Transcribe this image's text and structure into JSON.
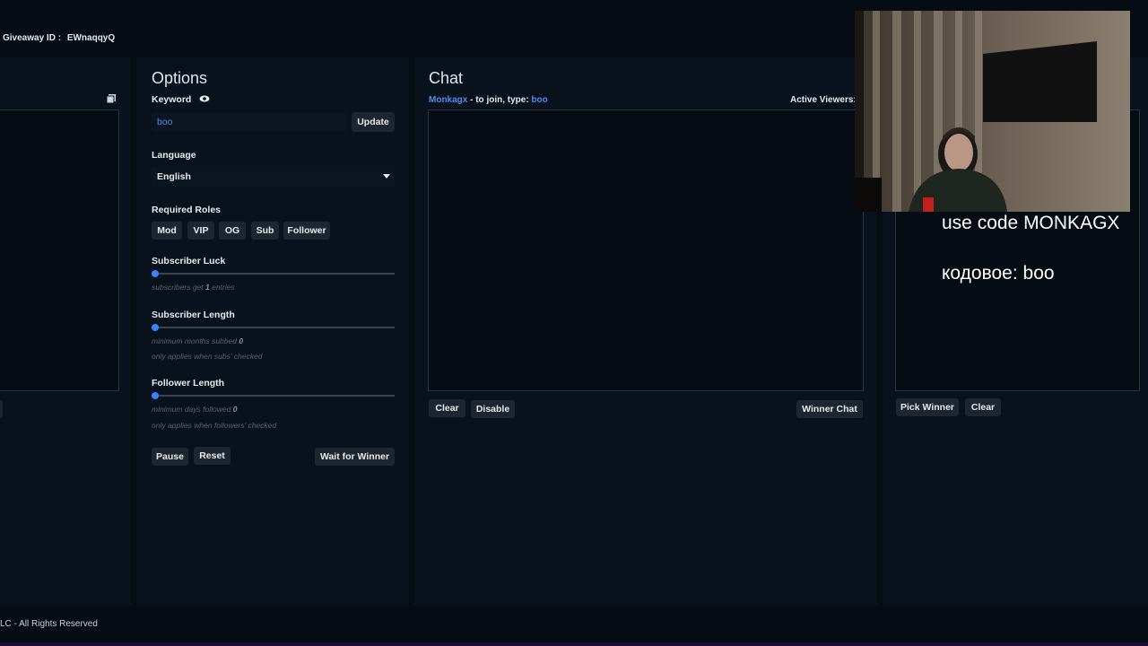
{
  "header": {
    "giveaway_label": "Giveaway ID :",
    "giveaway_id": "EWnaqqyQ"
  },
  "options": {
    "title": "Options",
    "keyword_label": "Keyword",
    "keyword_value": "boo",
    "update_button": "Update",
    "language_label": "Language",
    "language_value": "English",
    "required_roles_label": "Required Roles",
    "roles": [
      "Mod",
      "VIP",
      "OG",
      "Sub",
      "Follower"
    ],
    "subscriber_luck_label": "Subscriber Luck",
    "subscriber_luck_note_pre": "subscribers get",
    "subscriber_luck_value": "1",
    "subscriber_luck_note_post": "entries",
    "subscriber_length_label": "Subscriber Length",
    "subscriber_length_note": "minimum months subbed",
    "subscriber_length_value": "0",
    "subscriber_length_note2": "only applies when subs' checked",
    "follower_length_label": "Follower Length",
    "follower_length_note": "minimum days followed",
    "follower_length_value": "0",
    "follower_length_note2": "only applies when followers' checked",
    "slider_levels": [
      0,
      0,
      0
    ],
    "pause_button": "Pause",
    "reset_button": "Reset",
    "wait_button": "Wait for Winner"
  },
  "chat": {
    "title": "Chat",
    "channel": "Monkagx",
    "join_text": " - to join, type: ",
    "keyword": "boo",
    "active_viewers_label": "Active Viewers:",
    "clear_button": "Clear",
    "disable_button": "Disable",
    "winner_chat_button": "Winner Chat"
  },
  "winner": {
    "pick_button": "Pick Winner",
    "clear_button": "Clear"
  },
  "overlay": {
    "line1": "use code MONKAGX",
    "line2": "кодовое: boo"
  },
  "footer": {
    "text": "LC - All Rights Reserved"
  },
  "colors": {
    "accent": "#3b82f6",
    "background": "#050c14",
    "panel": "#08111c"
  }
}
